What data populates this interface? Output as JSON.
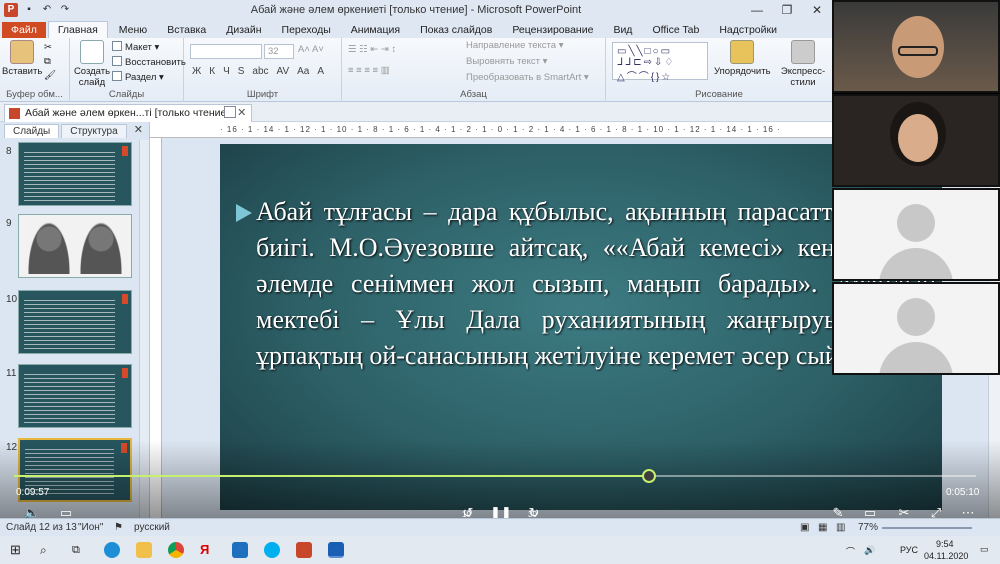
{
  "window": {
    "title": "Абай және әлем өркениеті [только чтение] - Microsoft PowerPoint",
    "app_icon": "P",
    "controls": [
      "—",
      "❐",
      "✕"
    ]
  },
  "ribbon": {
    "tabs": [
      "Файл",
      "Главная",
      "Меню",
      "Вставка",
      "Дизайн",
      "Переходы",
      "Анимация",
      "Показ слайдов",
      "Рецензирование",
      "Вид",
      "Office Tab",
      "Надстройки"
    ],
    "active_tab": "Главная",
    "clipboard": {
      "paste": "Вставить",
      "label": "Буфер обм..."
    },
    "slides": {
      "new_slide": "Создать слайд",
      "layout": "Макет",
      "reset": "Восстановить",
      "section": "Раздел",
      "label": "Слайды"
    },
    "font": {
      "font_name": "",
      "font_size": "32",
      "format_buttons": [
        "Ж",
        "К",
        "Ч",
        "S",
        "abc",
        "AV",
        "Aa",
        "A"
      ],
      "label": "Шрифт"
    },
    "paragraph": {
      "text_direction": "Направление текста",
      "align_text": "Выровнять текст",
      "smartart": "Преобразовать в SmartArt",
      "label": "Абзац"
    },
    "drawing": {
      "arrange": "Упорядочить",
      "quick_styles": "Экспресс-стили",
      "label": "Рисование"
    }
  },
  "doc_tab": {
    "title": "Абай және әлем өркен...ті [только чтение]"
  },
  "left_pane": {
    "tabs": [
      "Слайды",
      "Структура"
    ],
    "active_tab": "Слайды",
    "thumbnails": [
      {
        "number": "8",
        "kind": "text"
      },
      {
        "number": "9",
        "kind": "portraits"
      },
      {
        "number": "10",
        "kind": "text"
      },
      {
        "number": "11",
        "kind": "text"
      },
      {
        "number": "12",
        "kind": "text",
        "selected": true
      }
    ]
  },
  "ruler": {
    "marks": "· 16 · 1 · 14 · 1 · 12 · 1 · 10 · 1 · 8 · 1 · 6 · 1 · 4 · 1 · 2 · 1 · 0 · 1 · 2 · 1 · 4 · 1 · 6 · 1 · 8 · 1 · 10 · 1 · 12 · 1 · 14 · 1 · 16 ·"
  },
  "slide": {
    "text": "Абай тұлғасы – дара құбылыс, ақынның парасаттың асқар биігі. М.О.Әуезовше айтсақ, ««Абай кемесі» кең жарқын әлемде сеніммен жол сызып, маңып барады». Абайдың мектебі – Ұлы Дала руханиятының жаңғыруына, жас ұрпақтың ой-санасының жетілуіне керемет әсер сыйлайды."
  },
  "player": {
    "current_time": "0:09:57",
    "total_time": "0:05:10",
    "progress": 0.66,
    "rewind_label": "10",
    "forward_label": "30"
  },
  "statusbar": {
    "slide_info": "Слайд 12 из 13",
    "theme": "\"Ион\"",
    "language": "русский",
    "zoom": "77%"
  },
  "taskbar": {
    "language": "РУС",
    "time": "9:54",
    "date": "04.11.2020"
  },
  "participants": [
    {
      "kind": "camera",
      "name": ""
    },
    {
      "kind": "camera",
      "name": ""
    },
    {
      "kind": "avatar",
      "name": ""
    },
    {
      "kind": "avatar",
      "name": ""
    }
  ]
}
